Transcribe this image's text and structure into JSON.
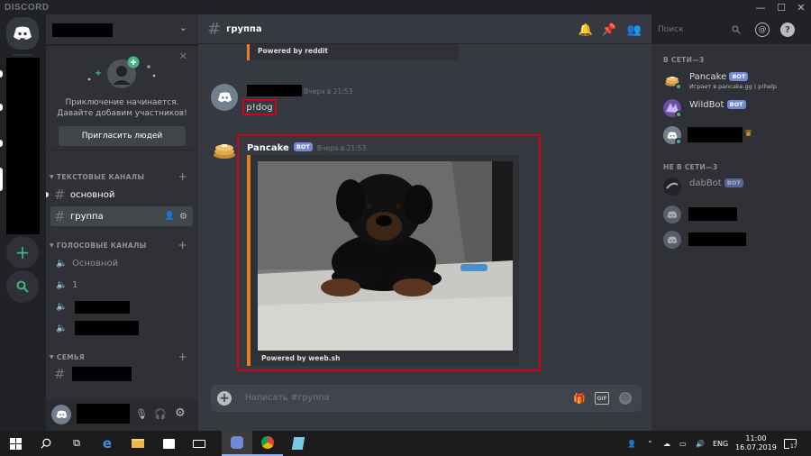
{
  "window": {
    "title": "DISCORD",
    "minimize": "—",
    "maximize": "☐",
    "close": "✕"
  },
  "sidebar": {
    "invite": {
      "line1": "Приключение начинается.",
      "line2": "Давайте добавим участников!",
      "button": "Пригласить людей"
    },
    "categories": {
      "text": "ТЕКСТОВЫЕ КАНАЛЫ",
      "voice": "ГОЛОСОВЫЕ КАНАЛЫ",
      "family": "СЕМЬЯ"
    },
    "text_channels": [
      {
        "name": "основной"
      },
      {
        "name": "группа"
      }
    ],
    "voice_channels": [
      {
        "name": "Основной"
      },
      {
        "name": "1"
      }
    ]
  },
  "header": {
    "channel": "группа",
    "search_placeholder": "Поиск"
  },
  "messages": {
    "top_embed_footer": "Powered by reddit",
    "first": {
      "time": "Вчера в 21:53",
      "text": "p!dog"
    },
    "second": {
      "author": "Pancake",
      "badge": "BOT",
      "time": "Вчера в 21:53",
      "embed_footer": "Powered by weeb.sh"
    }
  },
  "input": {
    "placeholder": "Написать #группа"
  },
  "members": {
    "online_title": "В СЕТИ—3",
    "offline_title": "НЕ В СЕТИ—3",
    "online": [
      {
        "name": "Pancake",
        "badge": "BOT",
        "activity": "Играет в pancake.gg | p!help"
      },
      {
        "name": "WildBot",
        "badge": "BOT"
      }
    ],
    "offline": [
      {
        "name": "dabBot",
        "badge": "BOT"
      }
    ]
  },
  "taskbar": {
    "lang": "ENG",
    "time": "11:00",
    "date": "16.07.2019",
    "notifications": "17"
  },
  "colors": {
    "accent": "#7289da",
    "online": "#43b581",
    "highlight": "#d0021b",
    "embed_border": "#e67e22"
  }
}
